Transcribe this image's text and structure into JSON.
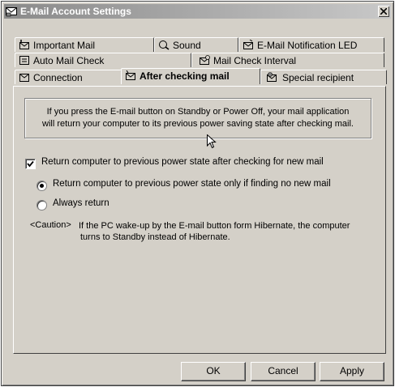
{
  "window": {
    "title": "E-Mail Account Settings",
    "title_icon": "mail-settings-icon",
    "close_icon": "close-icon"
  },
  "tabs": {
    "row1": [
      {
        "label": "Important Mail",
        "icon": "important-mail-icon"
      },
      {
        "label": "Sound",
        "icon": "sound-icon"
      },
      {
        "label": "E-Mail Notification LED",
        "icon": "led-icon"
      }
    ],
    "row2": [
      {
        "label": "Auto Mail Check",
        "icon": "auto-mail-check-icon"
      },
      {
        "label": "Mail Check Interval",
        "icon": "mail-interval-icon"
      }
    ],
    "row3": [
      {
        "label": "Connection",
        "icon": "connection-icon"
      },
      {
        "label": "After checking mail",
        "icon": "after-check-icon",
        "active": true
      },
      {
        "label": "Special recipient",
        "icon": "special-recipient-icon"
      }
    ]
  },
  "panel": {
    "info_line1": "If you press the E-mail button on Standby or Power Off, your mail application",
    "info_line2": "will return your computer to its previous power saving state after checking mail.",
    "checkbox_return": {
      "label": "Return computer to previous power state after checking for new mail",
      "checked": true
    },
    "radio_only_none": {
      "label": "Return computer to previous power state only if finding no new mail",
      "selected": true
    },
    "radio_always": {
      "label": "Always return",
      "selected": false
    },
    "caution_tag": "<Caution>",
    "caution_line1": "If the PC wake-up by the E-mail button form Hibernate, the computer",
    "caution_line2": "turns to Standby instead of Hibernate."
  },
  "buttons": {
    "ok": "OK",
    "cancel": "Cancel",
    "apply": "Apply"
  }
}
